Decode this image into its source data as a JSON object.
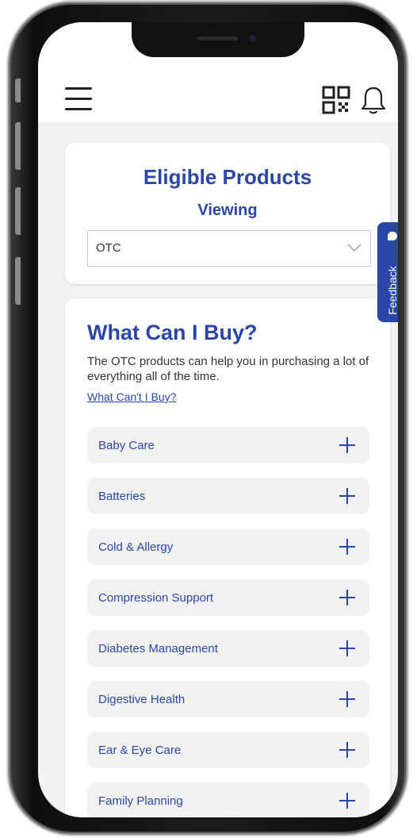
{
  "header": {
    "menu_icon": "hamburger-menu-icon",
    "qr_icon": "qr-code-icon",
    "bell_icon": "notification-bell-icon"
  },
  "eligible": {
    "title": "Eligible Products",
    "subtitle": "Viewing",
    "select_value": "OTC"
  },
  "feedback": {
    "label": "Feedback"
  },
  "buy": {
    "heading": "What Can I Buy?",
    "description": "The OTC products can help you in purchasing a lot of everything all of the time.",
    "link": "What Can't I Buy?",
    "categories": [
      "Baby Care",
      "Batteries",
      "Cold & Allergy",
      "Compression Support",
      "Diabetes Management",
      "Digestive Health",
      "Ear & Eye Care",
      "Family Planning"
    ]
  },
  "colors": {
    "brand_blue": "#2a46a6",
    "page_bg": "#f2f2f2"
  }
}
